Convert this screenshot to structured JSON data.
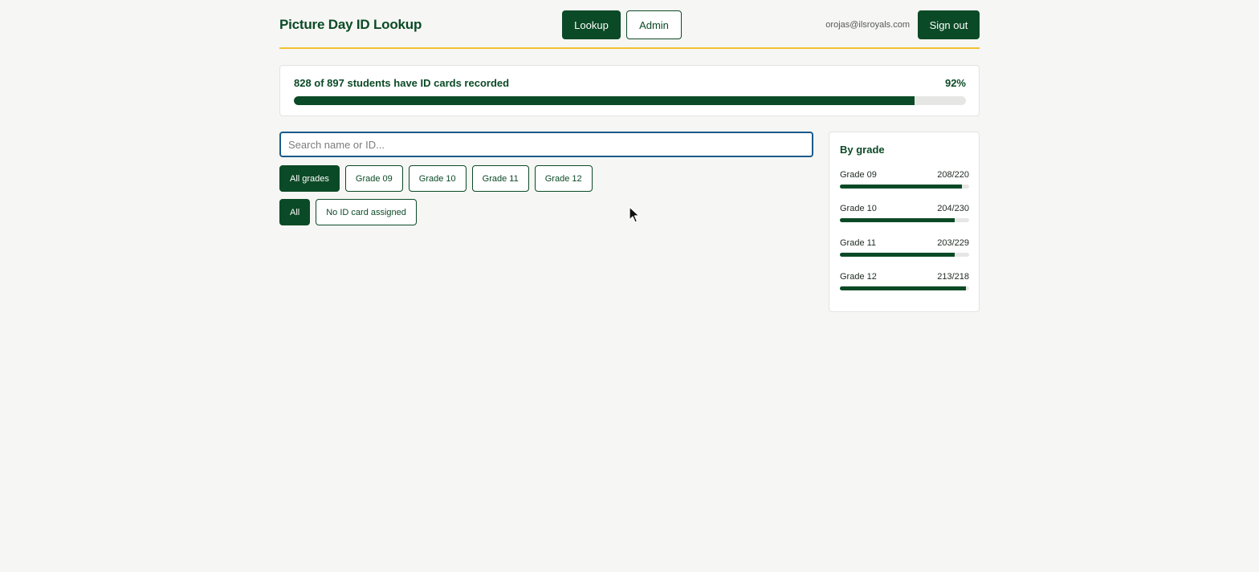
{
  "header": {
    "title": "Picture Day ID Lookup",
    "nav": {
      "lookup_label": "Lookup",
      "admin_label": "Admin"
    },
    "user_email": "orojas@ilsroyals.com",
    "signout_label": "Sign out"
  },
  "progress": {
    "text": "828 of 897 students have ID cards recorded",
    "percent_label": "92%",
    "recorded": 828,
    "total": 897
  },
  "search": {
    "placeholder": "Search name or ID...",
    "value": ""
  },
  "grade_filters": [
    {
      "label": "All grades",
      "active": true
    },
    {
      "label": "Grade 09",
      "active": false
    },
    {
      "label": "Grade 10",
      "active": false
    },
    {
      "label": "Grade 11",
      "active": false
    },
    {
      "label": "Grade 12",
      "active": false
    }
  ],
  "status_filters": [
    {
      "label": "All",
      "active": true
    },
    {
      "label": "No ID card assigned",
      "active": false
    }
  ],
  "by_grade": {
    "title": "By grade",
    "rows": [
      {
        "label": "Grade 09",
        "count": "208/220",
        "done": 208,
        "total": 220
      },
      {
        "label": "Grade 10",
        "count": "204/230",
        "done": 204,
        "total": 230
      },
      {
        "label": "Grade 11",
        "count": "203/229",
        "done": 203,
        "total": 229
      },
      {
        "label": "Grade 12",
        "count": "213/218",
        "done": 213,
        "total": 218
      }
    ]
  },
  "colors": {
    "brand": "#0b4a26",
    "accent_rule": "#f2c232",
    "search_focus": "#1b5a8a"
  },
  "icons": {
    "cursor": "mouse-pointer-icon"
  }
}
